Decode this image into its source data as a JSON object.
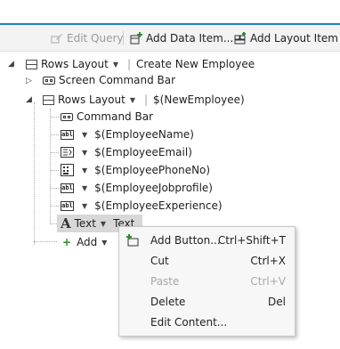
{
  "toolbar": {
    "edit_query": "Edit Query",
    "add_data_item": "Add Data Item...",
    "add_layout_item": "Add Layout Item"
  },
  "tree": {
    "root": {
      "layout": "Rows Layout",
      "name": "Create New Employee"
    },
    "screen_command_bar": "Screen Command Bar",
    "inner": {
      "layout": "Rows Layout",
      "name": "$(NewEmployee)"
    },
    "command_bar": "Command Bar",
    "fields": [
      {
        "icon": "textbox-icon",
        "label": "$(EmployeeName)"
      },
      {
        "icon": "email-address-icon",
        "label": "$(EmployeeEmail)"
      },
      {
        "icon": "phone-number-icon",
        "label": "$(EmployeePhoneNo)"
      },
      {
        "icon": "textbox-icon",
        "label": "$(EmployeeJobprofile)"
      },
      {
        "icon": "textbox-icon",
        "label": "$(EmployeeExperience)"
      }
    ],
    "text_item": {
      "type": "Text",
      "value": "Text"
    },
    "add": "Add"
  },
  "context_menu": {
    "items": [
      {
        "label": "Add Button...",
        "shortcut": "Ctrl+Shift+T",
        "enabled": true
      },
      {
        "label": "Cut",
        "shortcut": "Ctrl+X",
        "enabled": true
      },
      {
        "label": "Paste",
        "shortcut": "Ctrl+V",
        "enabled": false
      },
      {
        "label": "Delete",
        "shortcut": "Del",
        "enabled": true
      },
      {
        "label": "Edit Content...",
        "shortcut": "",
        "enabled": true
      }
    ]
  },
  "colors": {
    "accent": "#1e7fc8",
    "selection": "#d8d8d8",
    "add_green": "#2e8b2e"
  }
}
